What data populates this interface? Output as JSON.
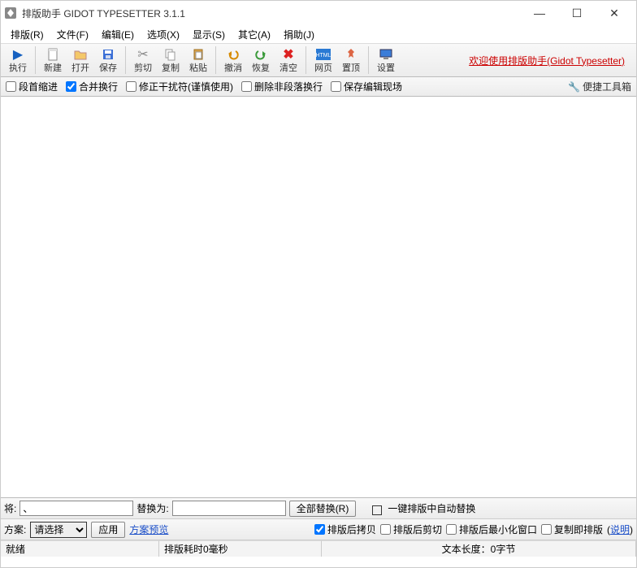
{
  "window": {
    "title": "排版助手 GIDOT TYPESETTER 3.1.1"
  },
  "winctrl": {
    "min": "—",
    "max": "☐",
    "close": "✕"
  },
  "menu": {
    "layout": "排版(R)",
    "file": "文件(F)",
    "edit": "编辑(E)",
    "options": "选项(X)",
    "view": "显示(S)",
    "other": "其它(A)",
    "donate": "捐助(J)"
  },
  "toolbar": {
    "run": "执行",
    "new": "新建",
    "open": "打开",
    "save": "保存",
    "cut": "剪切",
    "copy": "复制",
    "paste": "粘贴",
    "undo": "撤消",
    "redo": "恢复",
    "clear": "清空",
    "web": "网页",
    "top": "置顶",
    "settings": "设置",
    "brand": "欢迎使用排版助手(Gidot Typesetter)"
  },
  "options": {
    "indent": "段首缩进",
    "merge_line": "合并换行",
    "fix_noise": "修正干扰符(谨慎使用)",
    "del_nonpara": "删除非段落换行",
    "save_scene": "保存编辑现场",
    "handytool": "便捷工具箱"
  },
  "replace": {
    "find_label": "将:",
    "find_value": "、",
    "replace_label": "替换为:",
    "replace_value": "",
    "all_btn": "全部替换(R)",
    "onekey_auto": "一键排版中自动替换"
  },
  "scheme": {
    "label": "方案:",
    "selected": "请选择",
    "apply": "应用",
    "preview": "方案预览",
    "after_copy": "排版后拷贝",
    "after_cut": "排版后剪切",
    "after_min": "排版后最小化窗口",
    "copy_layout": "复制即排版",
    "help": "说明"
  },
  "status": {
    "ready": "就绪",
    "time": "排版耗时0毫秒",
    "length": "文本长度：0字节"
  }
}
